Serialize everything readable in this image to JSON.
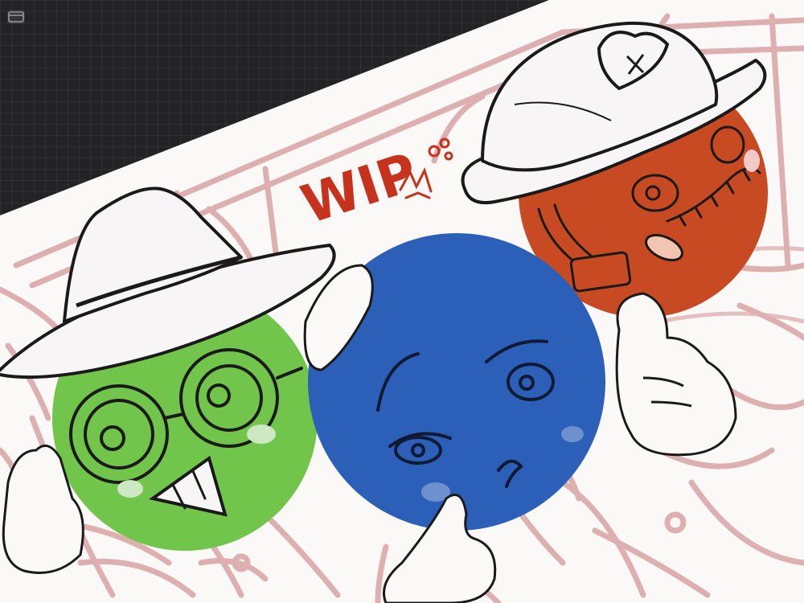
{
  "app": {
    "gallery_button_icon": "gallery-icon",
    "background_color": "#232325"
  },
  "canvas": {
    "paper_color": "#fbf8f8",
    "sketch_color": "#d9a3a3",
    "ink_color": "#141414",
    "annotation": "WIP",
    "annotation_color": "#c6321b"
  },
  "characters": [
    {
      "name": "green-character",
      "color": "#72c54b",
      "hat": "fedora"
    },
    {
      "name": "blue-character",
      "color": "#2c5fb8",
      "hat": "none"
    },
    {
      "name": "orange-character",
      "color": "#c84a22",
      "hat": "hard-hat"
    }
  ]
}
